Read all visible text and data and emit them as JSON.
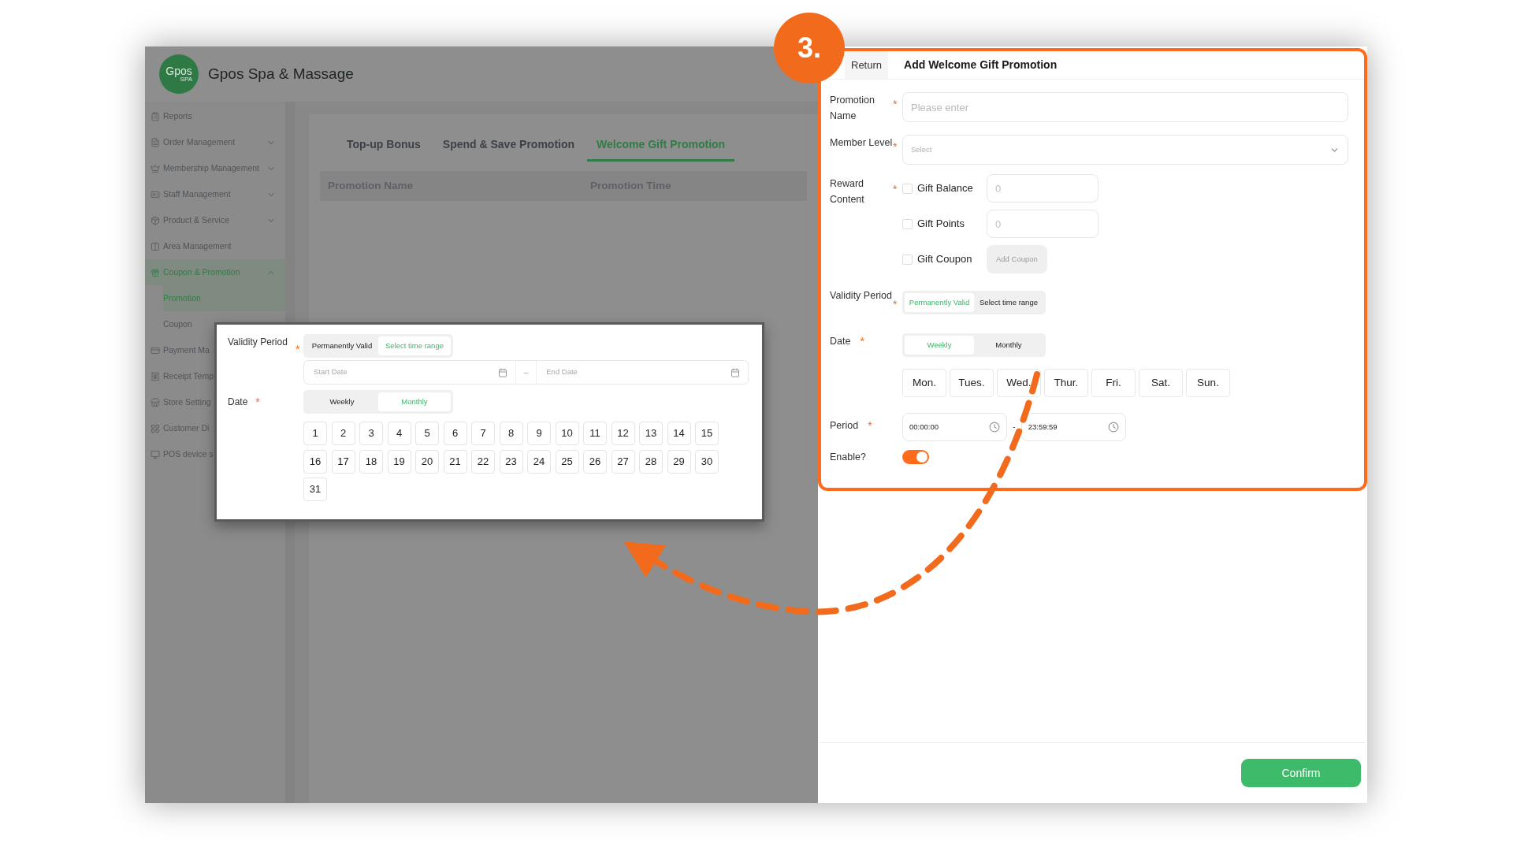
{
  "app": {
    "logo": "Gpos",
    "logo_sub": "SPA",
    "name": "Gpos Spa & Massage"
  },
  "sidebar": {
    "items": [
      {
        "label": "Reports",
        "selected": false
      },
      {
        "label": "Order Management",
        "selected": false,
        "expanded": false
      },
      {
        "label": "Membership Management",
        "selected": false,
        "expanded": false
      },
      {
        "label": "Staff Management",
        "selected": false,
        "expanded": false
      },
      {
        "label": "Product & Service",
        "selected": false,
        "expanded": false
      },
      {
        "label": "Area Management",
        "selected": false
      },
      {
        "label": "Coupon & Promotion",
        "selected": true,
        "expanded": true,
        "children": [
          {
            "label": "Promotion",
            "selected": true
          },
          {
            "label": "Coupon",
            "selected": false
          }
        ]
      },
      {
        "label": "Payment Ma",
        "selected": false
      },
      {
        "label": "Receipt Temp",
        "selected": false
      },
      {
        "label": "Store Setting",
        "selected": false
      },
      {
        "label": "Customer Di",
        "selected": false
      },
      {
        "label": "POS device s",
        "selected": false
      }
    ]
  },
  "tabs": [
    {
      "label": "Top-up Bonus",
      "selected": false
    },
    {
      "label": "Spend & Save Promotion",
      "selected": false
    },
    {
      "label": "Welcome Gift Promotion",
      "selected": true
    }
  ],
  "table": {
    "columns": [
      "Promotion Name",
      "Promotion Time"
    ]
  },
  "drawer": {
    "back": "Return",
    "title": "Add Welcome Gift Promotion",
    "promotion_name": {
      "label": "Promotion Name",
      "required": "*",
      "placeholder": "Please enter"
    },
    "member_level": {
      "label": "Member Level",
      "required": "*",
      "placeholder": "Select"
    },
    "reward_content": {
      "label": "Reward Content",
      "required": "*",
      "options": [
        {
          "kind": "input",
          "label": "Gift Balance",
          "checked": false,
          "placeholder": "0"
        },
        {
          "kind": "input",
          "label": "Gift Points",
          "checked": false,
          "placeholder": "0"
        },
        {
          "kind": "button",
          "label": "Gift Coupon",
          "checked": false,
          "button": "Add Coupon",
          "disabled": true
        }
      ]
    },
    "validity": {
      "label": "Validity Period",
      "required": "*",
      "options": [
        {
          "label": "Permanently Valid",
          "selected": true
        },
        {
          "label": "Select time range",
          "selected": false
        }
      ]
    },
    "date": {
      "label": "Date",
      "required": "*",
      "modes": [
        {
          "label": "Weekly",
          "selected": true
        },
        {
          "label": "Monthly",
          "selected": false
        }
      ],
      "days": [
        {
          "label": "Mon.",
          "selected": false
        },
        {
          "label": "Tues.",
          "selected": false
        },
        {
          "label": "Wed.",
          "selected": false
        },
        {
          "label": "Thur.",
          "selected": false
        },
        {
          "label": "Fri.",
          "selected": false
        },
        {
          "label": "Sat.",
          "selected": false
        },
        {
          "label": "Sun.",
          "selected": false
        }
      ]
    },
    "period": {
      "label": "Period",
      "required": "*",
      "start": "00:00:00",
      "separator": "-",
      "end": "23:59:59"
    },
    "enable": {
      "label": "Enable?",
      "on": true
    },
    "confirm": "Confirm"
  },
  "callout": {
    "validity": {
      "label": "Validity Period",
      "required": "*",
      "options": [
        {
          "label": "Permanently Valid",
          "selected": false
        },
        {
          "label": "Select time range",
          "selected": true
        }
      ]
    },
    "date_range": {
      "start_placeholder": "Start Date",
      "separator": "–",
      "end_placeholder": "End Date"
    },
    "date": {
      "label": "Date",
      "required": "*",
      "modes": [
        {
          "label": "Weekly",
          "selected": false
        },
        {
          "label": "Monthly",
          "selected": true
        }
      ],
      "days": [
        {
          "label": "1",
          "selected": false
        },
        {
          "label": "2",
          "selected": false
        },
        {
          "label": "3",
          "selected": false
        },
        {
          "label": "4",
          "selected": false
        },
        {
          "label": "5",
          "selected": false
        },
        {
          "label": "6",
          "selected": false
        },
        {
          "label": "7",
          "selected": false
        },
        {
          "label": "8",
          "selected": false
        },
        {
          "label": "9",
          "selected": false
        },
        {
          "label": "10",
          "selected": false
        },
        {
          "label": "11",
          "selected": false
        },
        {
          "label": "12",
          "selected": false
        },
        {
          "label": "13",
          "selected": false
        },
        {
          "label": "14",
          "selected": false
        },
        {
          "label": "15",
          "selected": false
        },
        {
          "label": "16",
          "selected": false
        },
        {
          "label": "17",
          "selected": false
        },
        {
          "label": "18",
          "selected": false
        },
        {
          "label": "19",
          "selected": false
        },
        {
          "label": "20",
          "selected": false
        },
        {
          "label": "21",
          "selected": false
        },
        {
          "label": "22",
          "selected": false
        },
        {
          "label": "23",
          "selected": false
        },
        {
          "label": "24",
          "selected": false
        },
        {
          "label": "25",
          "selected": false
        },
        {
          "label": "26",
          "selected": false
        },
        {
          "label": "27",
          "selected": false
        },
        {
          "label": "28",
          "selected": false
        },
        {
          "label": "29",
          "selected": false
        },
        {
          "label": "30",
          "selected": false
        },
        {
          "label": "31",
          "selected": false
        }
      ]
    }
  },
  "annotation": {
    "step": "3."
  }
}
